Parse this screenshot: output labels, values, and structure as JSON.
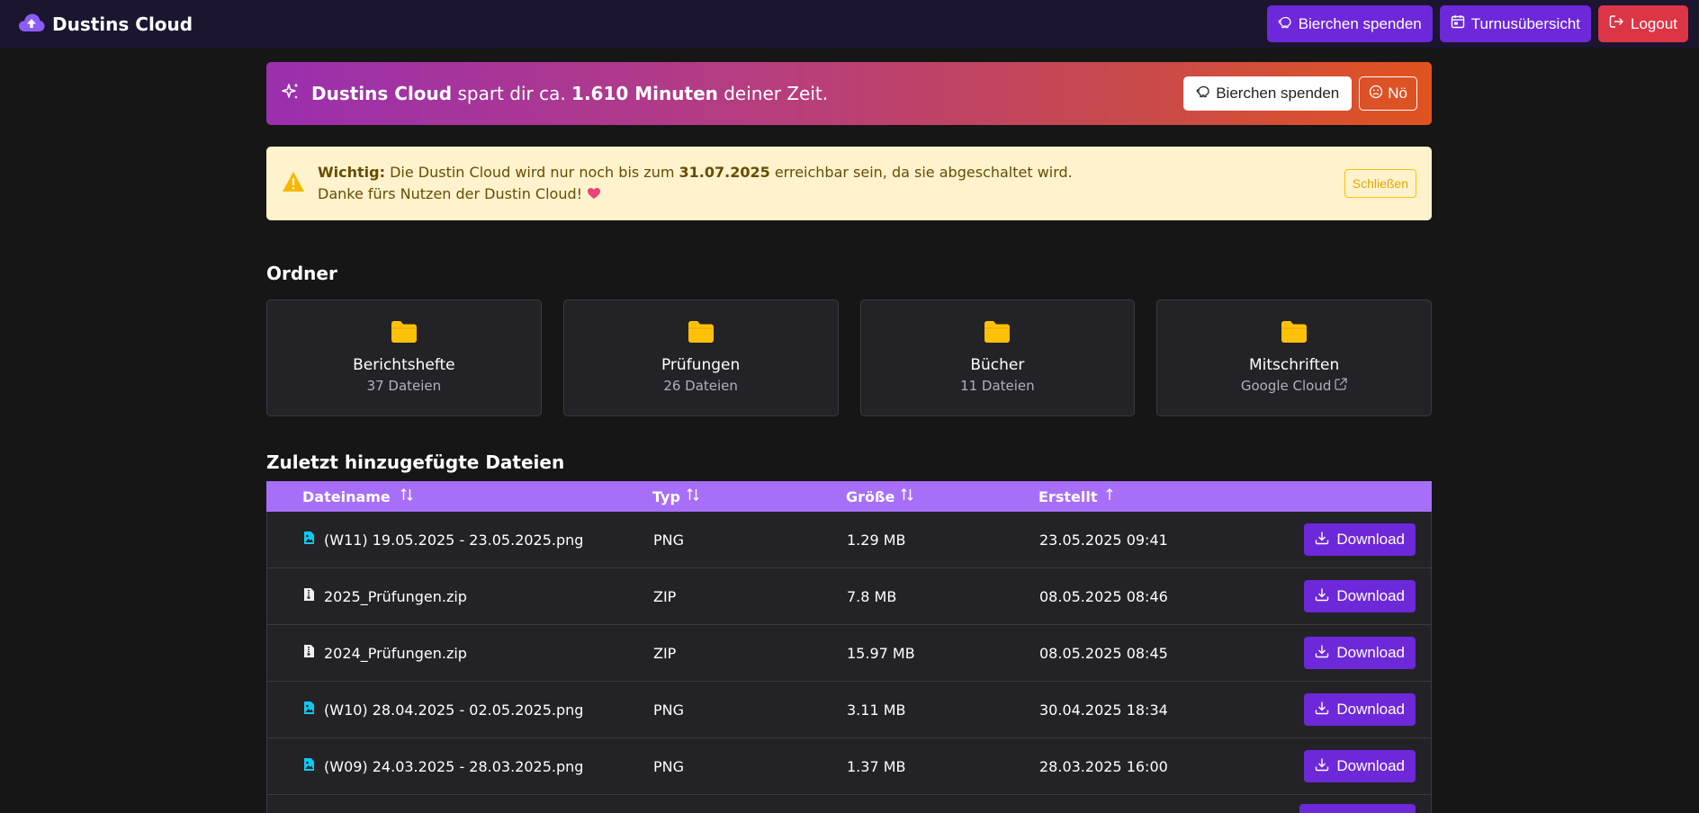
{
  "navbar": {
    "brand": "Dustins Cloud",
    "btn_donate": "Bierchen spenden",
    "btn_turnus": "Turnusübersicht",
    "btn_logout": "Logout"
  },
  "promo": {
    "brand": "Dustins Cloud",
    "text_mid": " spart dir ca. ",
    "minutes": "1.610 Minuten",
    "text_end": " deiner Zeit.",
    "btn_donate": "Bierchen spenden",
    "btn_no": "Nö"
  },
  "alert": {
    "label": "Wichtig:",
    "text_mid": " Die Dustin Cloud wird nur noch bis zum ",
    "date": "31.07.2025",
    "text_end": " erreichbar sein, da sie abgeschaltet wird.",
    "line2": "Danke fürs Nutzen der Dustin Cloud!",
    "close": "Schließen"
  },
  "folders_title": "Ordner",
  "folders": [
    {
      "name": "Berichtshefte",
      "count": "37 Dateien"
    },
    {
      "name": "Prüfungen",
      "count": "26 Dateien"
    },
    {
      "name": "Bücher",
      "count": "11 Dateien"
    },
    {
      "name": "Mitschriften",
      "count": "Google Cloud"
    }
  ],
  "files_title": "Zuletzt hinzugefügte Dateien",
  "table": {
    "headers": {
      "name": "Dateiname",
      "type": "Typ",
      "size": "Größe",
      "created": "Erstellt"
    },
    "download_label": "Download",
    "rows": [
      {
        "name": "(W11) 19.05.2025 - 23.05.2025.png",
        "type": "PNG",
        "size": "1.29 MB",
        "created": "23.05.2025 09:41"
      },
      {
        "name": "2025_Prüfungen.zip",
        "type": "ZIP",
        "size": "7.8 MB",
        "created": "08.05.2025 08:46"
      },
      {
        "name": "2024_Prüfungen.zip",
        "type": "ZIP",
        "size": "15.97 MB",
        "created": "08.05.2025 08:45"
      },
      {
        "name": "(W10) 28.04.2025 - 02.05.2025.png",
        "type": "PNG",
        "size": "3.11 MB",
        "created": "30.04.2025 18:34"
      },
      {
        "name": "(W09) 24.03.2025 - 28.03.2025.png",
        "type": "PNG",
        "size": "1.37 MB",
        "created": "28.03.2025 16:00"
      }
    ]
  },
  "colors": {
    "accent": "#6d28d9",
    "table_header": "#a76ff8",
    "logout": "#dc3545",
    "folder_icon": "#ffc107",
    "image_icon": "#0dcaf0"
  }
}
